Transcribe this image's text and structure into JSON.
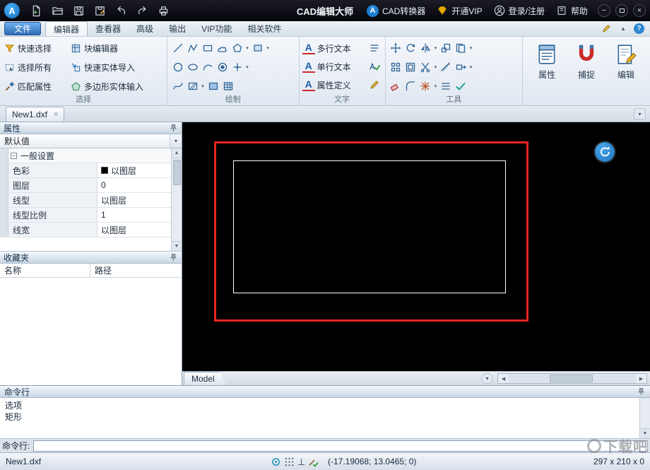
{
  "icons": {
    "dropdown": "▾",
    "close": "×",
    "minimize": "−",
    "help": "?",
    "scroll_up": "▲",
    "scroll_down": "▼",
    "scroll_left": "◀",
    "scroll_right": "▶",
    "chevron_down": "▾",
    "collapse_up": "▴",
    "perpendicular": "⊥",
    "tree_collapse": "−",
    "logo_letter": "A",
    "letter_a": "A"
  },
  "titlebar": {
    "title": "CAD编辑大师",
    "converter": "CAD转换器",
    "vip": "开通VIP",
    "login": "登录/注册",
    "help": "帮助"
  },
  "menubar": {
    "file_button": "文件",
    "tabs": [
      "编辑器",
      "查看器",
      "高级",
      "输出",
      "VIP功能",
      "相关软件"
    ]
  },
  "ribbon": {
    "selection": {
      "label": "选择",
      "items": [
        "快速选择",
        "块编辑器",
        "选择所有",
        "快速实体导入",
        "匹配属性",
        "多边形实体输入"
      ]
    },
    "draw": {
      "label": "绘制"
    },
    "text": {
      "label": "文字",
      "items": [
        "多行文本",
        "单行文本",
        "属性定义"
      ]
    },
    "tools": {
      "label": "工具"
    },
    "big_buttons": [
      "属性",
      "捕捉",
      "编辑"
    ]
  },
  "document": {
    "tab": "New1.dxf"
  },
  "properties": {
    "title": "属性",
    "preset": "默认值",
    "group": "一般设置",
    "rows": [
      {
        "label": "色彩",
        "value": "以图层"
      },
      {
        "label": "图层",
        "value": "0"
      },
      {
        "label": "线型",
        "value": "以图层"
      },
      {
        "label": "线型比例",
        "value": "1"
      },
      {
        "label": "线宽",
        "value": "以图层"
      }
    ]
  },
  "favorites": {
    "title": "收藏夹",
    "columns": [
      "名称",
      "路径"
    ]
  },
  "canvas": {
    "model_tab": "Model"
  },
  "command": {
    "title": "命令行",
    "history": [
      "选项",
      "矩形"
    ],
    "prompt": "命令行:"
  },
  "statusbar": {
    "filename": "New1.dxf",
    "coordinates": "(-17.19068; 13.0465; 0)",
    "dimensions": "297 x 210 x 0"
  },
  "watermark": "下载吧",
  "colors": {
    "accent": "#1d80d2",
    "highlight_red": "#e8231f",
    "canvas_bg": "#000000"
  }
}
